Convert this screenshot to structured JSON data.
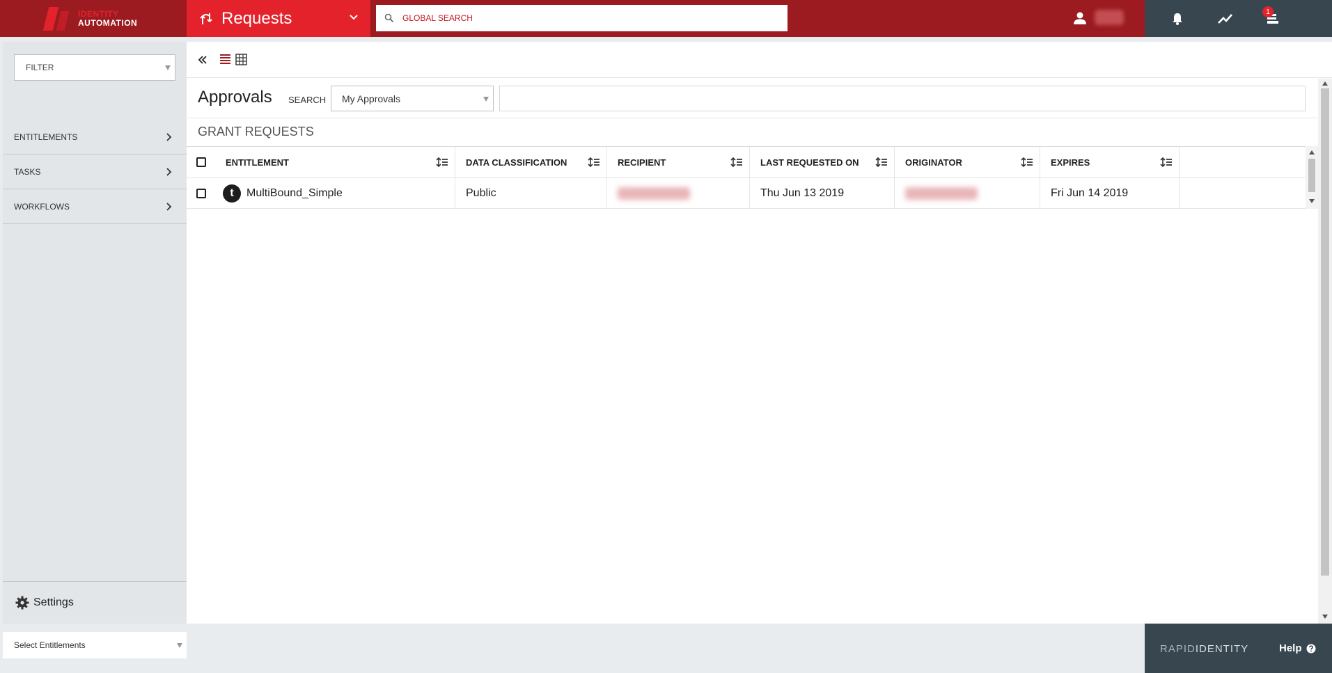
{
  "header": {
    "logo_line1": "IDENTITY",
    "logo_line2": "AUTOMATION",
    "module_title": "Requests",
    "global_search_placeholder": "GLOBAL SEARCH",
    "notifications_badge": "1"
  },
  "sidebar": {
    "filter_label": "FILTER",
    "items": [
      {
        "label": "ENTITLEMENTS"
      },
      {
        "label": "TASKS"
      },
      {
        "label": "WORKFLOWS"
      }
    ],
    "settings_label": "Settings",
    "bottom_select_label": "Select Entitlements"
  },
  "main": {
    "page_title": "Approvals",
    "search_label": "SEARCH",
    "search_scope": "My Approvals",
    "search_value": "",
    "section_title": "GRANT REQUESTS",
    "columns": [
      "ENTITLEMENT",
      "DATA CLASSIFICATION",
      "RECIPIENT",
      "LAST REQUESTED ON",
      "ORIGINATOR",
      "EXPIRES"
    ],
    "rows": [
      {
        "entitlement": "MultiBound_Simple",
        "entitlement_icon_letter": "t",
        "data_classification": "Public",
        "last_requested_on": "Thu Jun 13 2019",
        "expires": "Fri Jun 14 2019"
      }
    ]
  },
  "footer": {
    "brand_part1": "RAPID",
    "brand_part2": "IDENTITY",
    "help_label": "Help"
  },
  "colors": {
    "header_dark_red": "#9b1b20",
    "header_red": "#e3222b",
    "toolbar_slate": "#37464f",
    "sidebar_bg": "#e2e6e9"
  }
}
